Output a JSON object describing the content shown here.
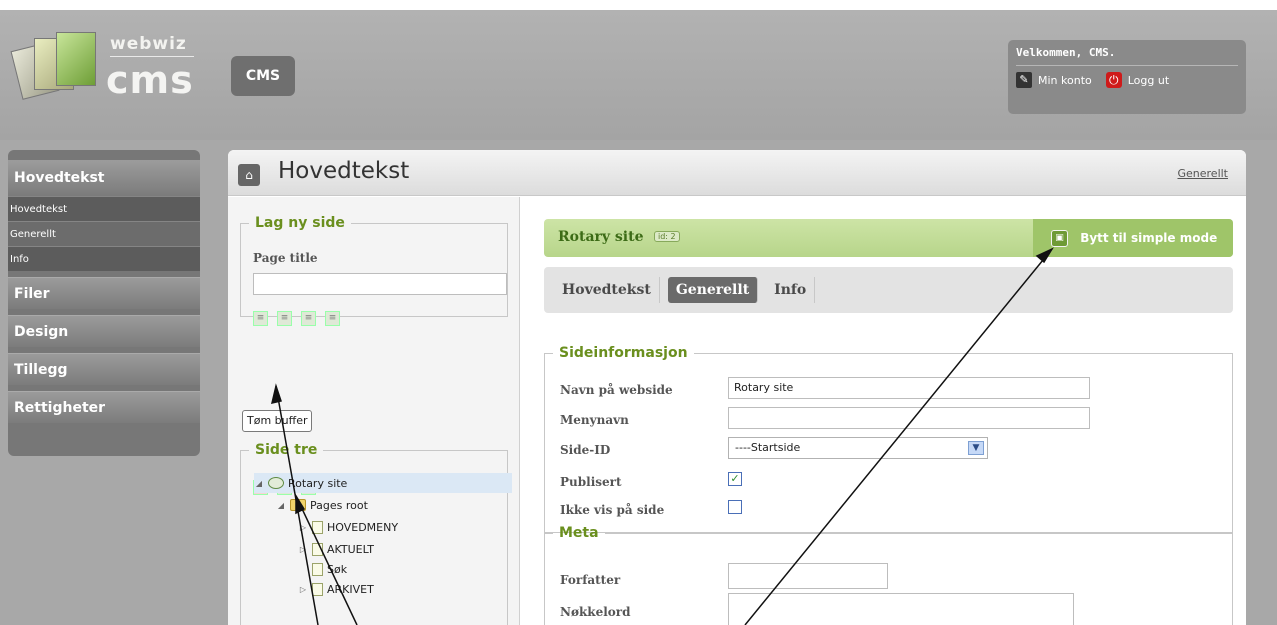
{
  "header": {
    "logo_small": "webwiz",
    "logo_big": "cms",
    "badge": "CMS",
    "welcome": "Velkommen, CMS.",
    "my_account": "Min konto",
    "logout": "Logg ut"
  },
  "sidebar": {
    "section_title": "Hovedtekst",
    "subitems": [
      "Hovedtekst",
      "Generellt",
      "Info"
    ],
    "menu": [
      "Filer",
      "Design",
      "Tillegg",
      "Rettigheter"
    ]
  },
  "main": {
    "title": "Hovedtekst",
    "top_link": "Generellt",
    "new_page": {
      "legend": "Lag ny side",
      "label": "Page title",
      "value": ""
    },
    "buffer_button": "Tøm buffer",
    "tree": {
      "legend": "Side tre",
      "nodes": [
        {
          "label": "Rotary site"
        },
        {
          "label": "Pages root"
        },
        {
          "label": "HOVEDMENY"
        },
        {
          "label": "AKTUELT"
        },
        {
          "label": "Søk"
        },
        {
          "label": "ARKIVET"
        }
      ]
    }
  },
  "site": {
    "name": "Rotary site",
    "id_badge": "id: 2",
    "simple_mode": "Bytt til simple mode",
    "tabs": [
      "Hovedtekst",
      "Generellt",
      "Info"
    ],
    "active_tab": "Generellt"
  },
  "sideinfo": {
    "legend": "Sideinformasjon",
    "web_name_label": "Navn på webside",
    "web_name_value": "Rotary site",
    "menu_name_label": "Menynavn",
    "menu_name_value": "",
    "page_id_label": "Side-ID",
    "page_id_value": "----Startside",
    "published_label": "Publisert",
    "published": true,
    "hide_label": "Ikke vis på side",
    "hidden": false
  },
  "meta": {
    "legend": "Meta",
    "author_label": "Forfatter",
    "author_value": "",
    "keywords_label": "Nøkkelord",
    "keywords_value": ""
  },
  "colors": {
    "accent_green": "#6a8f1e",
    "site_bar": "#b7d58a",
    "nav_bg": "#777777",
    "frame": "#a8a8a8"
  }
}
